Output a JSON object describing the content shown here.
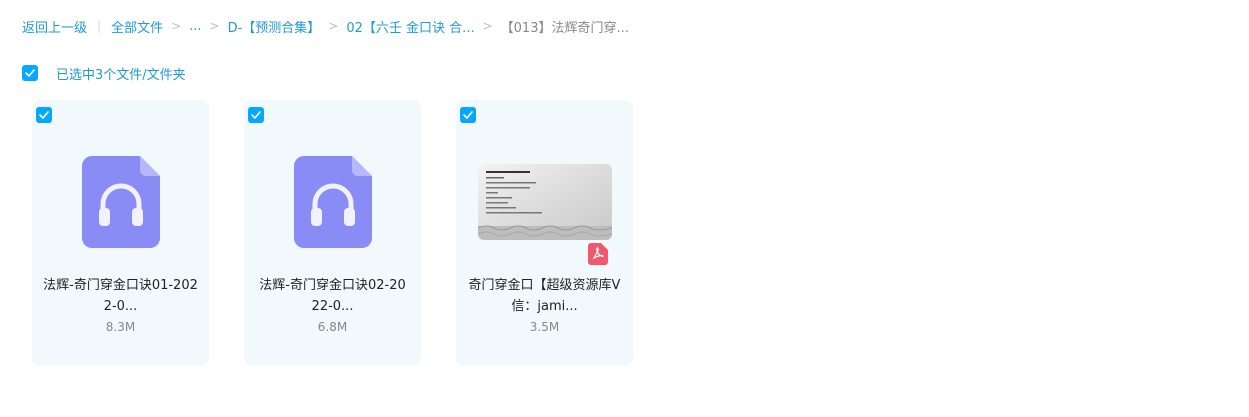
{
  "breadcrumb": {
    "back": "返回上一级",
    "items": [
      "全部文件",
      "...",
      "D-【预测合集】",
      "02【六壬 金口诀 合...",
      "【013】法辉奇门穿..."
    ]
  },
  "selection": {
    "label": "已选中3个文件/文件夹",
    "checked": true
  },
  "files": [
    {
      "name_line1": "法辉-奇门穿金口诀01-202",
      "name_line2": "2-0...",
      "size": "8.3M",
      "type": "audio",
      "selected": true
    },
    {
      "name_line1": "法辉-奇门穿金口诀02-20",
      "name_line2": "22-0...",
      "size": "6.8M",
      "type": "audio",
      "selected": true
    },
    {
      "name_line1": "奇门穿金口【超级资源库V",
      "name_line2": "信：jami...",
      "size": "3.5M",
      "type": "pdf",
      "selected": true
    }
  ],
  "colors": {
    "accent": "#06a7ff",
    "link": "#1f9ad6",
    "card_bg": "#f1f9fd",
    "audio_icon": "#8a8cf5",
    "pdf_badge": "#f0596b"
  }
}
